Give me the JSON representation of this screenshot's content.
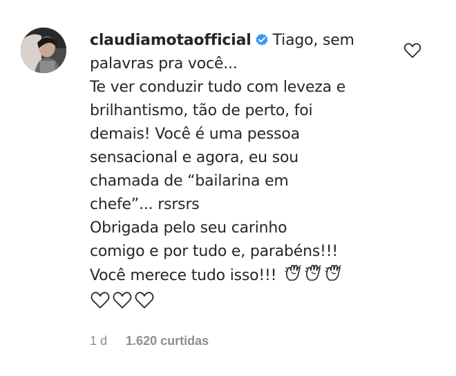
{
  "comment": {
    "username": "claudiamotaofficial",
    "lines": [
      "Tiago, sem",
      "palavras pra você...",
      "Te ver conduzir tudo com leveza e",
      "brilhantismo, tão de perto, foi",
      "demais! Você é uma pessoa",
      "sensacional e agora, eu sou",
      "chamada de “bailarina em",
      "chefe”... rsrsrs",
      "Obrigada pelo seu carinho",
      "comigo e por tudo e, parabéns!!!",
      "Você merece tudo isso!!!"
    ],
    "trailing_emoji": "clapping-hands-icon x3",
    "hearts_line": "white-heart-icon x3"
  },
  "meta": {
    "time": "1 d",
    "likes": "1.620 curtidas"
  },
  "colors": {
    "text": "#262626",
    "secondary": "#8e8e8e",
    "verified": "#3897f0"
  }
}
